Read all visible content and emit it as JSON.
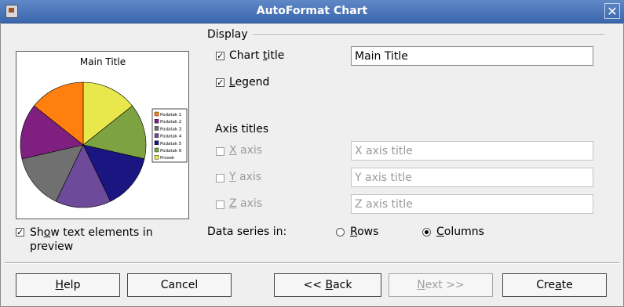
{
  "window": {
    "title": "AutoFormat Chart",
    "close": "✕"
  },
  "preview": {
    "chart_title": "Main Title",
    "legend": [
      "Podatak 1",
      "Podatak 2",
      "Podatak 3",
      "Podatak 4",
      "Podatak 5",
      "Podatak 6",
      "Prosek"
    ]
  },
  "display": {
    "group_label": "Display",
    "chart_title_cb": {
      "pre": "Chart ",
      "u": "t",
      "post": "itle",
      "checked": true
    },
    "legend_cb": {
      "pre": "",
      "u": "L",
      "post": "egend",
      "checked": true
    },
    "chart_title_value": "Main Title"
  },
  "axis_titles": {
    "label": "Axis titles",
    "x": {
      "pre": "",
      "u": "X",
      "post": " axis",
      "checked": false,
      "placeholder": "X axis title"
    },
    "y": {
      "pre": "",
      "u": "Y",
      "post": " axis",
      "checked": false,
      "placeholder": "Y axis title"
    },
    "z": {
      "pre": "",
      "u": "Z",
      "post": " axis",
      "checked": false,
      "placeholder": "Z axis title"
    }
  },
  "show_text": {
    "pre": "Sh",
    "u": "o",
    "post": "w text elements in",
    "line2": "preview",
    "checked": true
  },
  "data_series": {
    "label": "Data series in:",
    "rows": {
      "pre": "",
      "u": "R",
      "post": "ows",
      "selected": false
    },
    "columns": {
      "pre": "",
      "u": "C",
      "post": "olumns",
      "selected": true
    }
  },
  "buttons": {
    "help": {
      "pre": "",
      "u": "H",
      "post": "elp"
    },
    "cancel": {
      "pre": "Cancel",
      "u": "",
      "post": ""
    },
    "back": {
      "pre": "<< ",
      "u": "B",
      "post": "ack"
    },
    "next": {
      "pre": "",
      "u": "N",
      "post": "ext >>"
    },
    "create": {
      "pre": "Cre",
      "u": "a",
      "post": "te"
    }
  },
  "colors": {
    "pie": [
      "#ff7f0f",
      "#7f1f80",
      "#707070",
      "#6d4a9a",
      "#1a1580",
      "#7da242",
      "#e8e84c"
    ]
  }
}
